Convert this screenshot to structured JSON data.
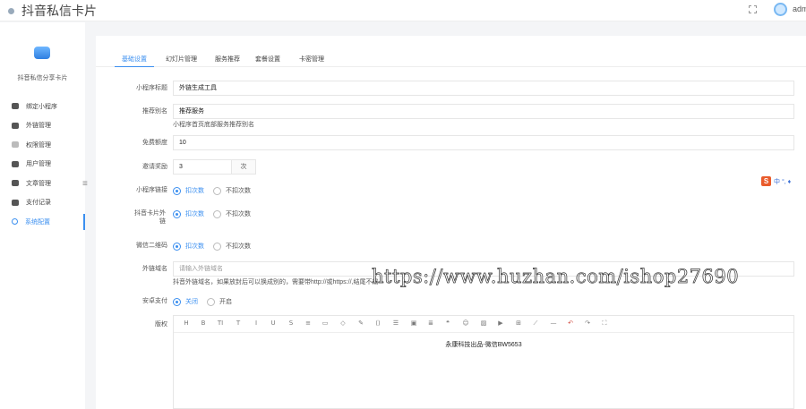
{
  "header": {
    "title": "抖音私信卡片",
    "user": "adm",
    "logo_icon": "app-logo-icon",
    "fullscreen_icon": "fullscreen-icon"
  },
  "sidebar": {
    "brand_name": "抖音私信分享卡片",
    "items": [
      {
        "label": "绑定小程序",
        "icon": "wechat-icon"
      },
      {
        "label": "外链管理",
        "icon": "link-icon"
      },
      {
        "label": "权限管理",
        "icon": "user-outline-icon"
      },
      {
        "label": "用户管理",
        "icon": "user-icon"
      },
      {
        "label": "文章管理",
        "icon": "article-icon"
      },
      {
        "label": "支付记录",
        "icon": "payment-icon"
      },
      {
        "label": "系统配置",
        "icon": "settings-icon"
      }
    ],
    "active_index": 6,
    "accent": "#3b8ff0"
  },
  "tabs": [
    "基础设置",
    "幻灯片管理",
    "服务推荐",
    "套餐设置",
    "卡密管理"
  ],
  "form": {
    "miniapp_title": {
      "label": "小程序标题",
      "value": "外链生成工具"
    },
    "recommend_alias": {
      "label": "推荐别名",
      "value": "推荐服务",
      "hint": "小程序首页底部服务推荐别名"
    },
    "free_quota": {
      "label": "免费额度",
      "value": "10"
    },
    "invite_reward": {
      "label": "邀请奖励",
      "value": "3",
      "suffix": "次"
    },
    "miniapp_link": {
      "label": "小程序链接",
      "options": [
        "扣次数",
        "不扣次数"
      ],
      "selected": 0
    },
    "douyin_card_link": {
      "label": "抖音卡片外链",
      "options": [
        "扣次数",
        "不扣次数"
      ],
      "selected": 0
    },
    "wechat_qrcode": {
      "label": "微信二维码",
      "options": [
        "扣次数",
        "不扣次数"
      ],
      "selected": 0
    },
    "external_domain": {
      "label": "外链域名",
      "placeholder": "请输入外链域名",
      "hint": "抖音外链域名，如果放封后可以换成别的，需要带http://或https://,结尾不需"
    },
    "secure_payment": {
      "label": "安卓支付",
      "options": [
        "关闭",
        "开启"
      ],
      "selected": 0
    },
    "copyright": {
      "label": "版权",
      "content": "永康科技出品-微信BW5653"
    }
  },
  "editor_toolbar": [
    "H",
    "B",
    "TI",
    "T",
    "I",
    "U",
    "S",
    "≡",
    "▭",
    "◇",
    "✎",
    "⟨⟩",
    "☰",
    "▣",
    "≣",
    "❝",
    "☺",
    "▨",
    "▶",
    "⊞",
    "⟋",
    "—",
    "↶",
    "↷",
    "⛶"
  ],
  "ime": {
    "brand": "S",
    "text": "中 °, ♦"
  },
  "watermark": "https://www.huzhan.com/ishop27690"
}
